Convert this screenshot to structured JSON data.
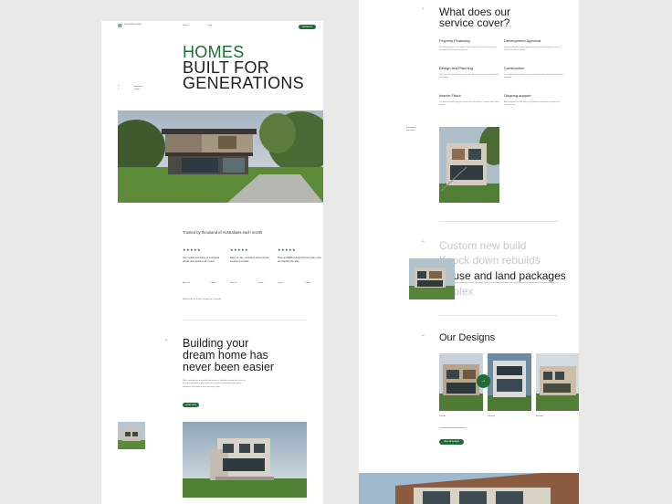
{
  "left": {
    "logo_mark": "W",
    "logo_text": "WILLOUGHBY HOMES",
    "nav": [
      "Homes",
      "Land"
    ],
    "nav_cta": "Contact us",
    "hero_title_line1": "HOMES",
    "hero_title_line2": "BUILT FOR",
    "hero_title_line3": "GENERATIONS",
    "hero_side_a": "S",
    "hero_side_b": "2",
    "hero_side_text": "Australian homes",
    "trusted_heading": "Trusted by thousand of Australians each month",
    "reviews": [
      {
        "stars": "★★★★★",
        "text": "Very quick and easy to complete whole was perfect as I need",
        "author": "Anton B.",
        "date": "1 week"
      },
      {
        "stars": "★★★★★",
        "text": "Easy to use, excellent and prompt service provided",
        "author": "Nina R.",
        "date": "2 days"
      },
      {
        "stars": "★★★★★",
        "text": "Now an $800 receipt this the team can we happily the way...",
        "author": "Liam T.",
        "date": "3 days"
      }
    ],
    "rated_note": "Rated 4.8/5 on 2,000+ reviews on Trustpilot",
    "building_title_line1": "Building your",
    "building_title_line2": "dream home has",
    "building_title_line3": "never been easier",
    "building_marker": "02",
    "building_body": "We're proud to be trusted by thousands of families to bring the vision of their dream home to life. From the very first consultation through to handover, our team is with you every step.",
    "building_cta": "Learn more"
  },
  "right": {
    "marker_services": "01",
    "services_title_line1": "What does our",
    "services_title_line2": "service cover?",
    "services": [
      {
        "title": "Property Financing",
        "body": "Our finance experts can help you find the right loan for your new home and guide you through the process."
      },
      {
        "title": "Development Approval",
        "body": "Our team handles council approvals, permits and compliance so your build starts without delays."
      },
      {
        "title": "Design and Planning",
        "body": "Work with our designers to create a floorplan that suits your land, lifestyle and budget."
      },
      {
        "title": "Construction",
        "body": "Our builders deliver quality construction with regular updates from slab to handover."
      },
      {
        "title": "Interior Fitout",
        "body": "Our interior team brings your home to life with finishes, fixtures and styling options."
      },
      {
        "title": "Ongoing support",
        "body": "After handover we stay with you, providing maintenance support and warranty care."
      }
    ],
    "services_side_note": "Everything you need",
    "types_marker": "03",
    "types": [
      "Custom new build",
      "Knock down rebuilds",
      "House and land packages",
      "Duplex"
    ],
    "designs_marker": "04",
    "designs_title": "Our Designs",
    "designs": [
      "Granite",
      "Islington",
      "Bayside"
    ],
    "designs_cta": "View all designs",
    "arrow_icon": "arrow-right-icon"
  },
  "colors": {
    "accent": "#1f6b38",
    "background": "#e9e9e7"
  }
}
